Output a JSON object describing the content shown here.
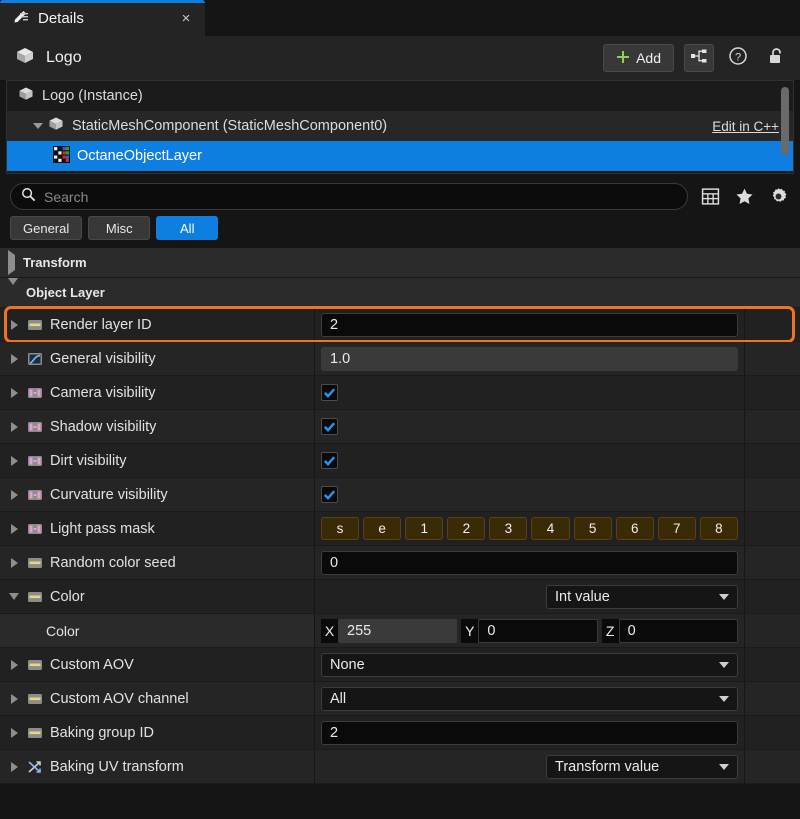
{
  "tab": {
    "label": "Details",
    "close": "×",
    "icon": "details-pencil-icon"
  },
  "header": {
    "title": "Logo",
    "add_label": "Add",
    "buttons": [
      "add-button",
      "hierarchy-button",
      "help-button",
      "lock-button"
    ]
  },
  "tree": {
    "rows": [
      {
        "label": "Logo (Instance)",
        "indent": 0,
        "selected": false,
        "icon": "cube-icon"
      },
      {
        "label": "StaticMeshComponent (StaticMeshComponent0)",
        "indent": 1,
        "selected": false,
        "icon": "cube-icon",
        "link": "Edit in C++"
      },
      {
        "label": "OctaneObjectLayer",
        "indent": 2,
        "selected": true,
        "icon": "octane-layer-icon"
      }
    ]
  },
  "search": {
    "placeholder": "Search",
    "value": "",
    "icons": [
      "grid-icon",
      "star-icon",
      "gear-icon"
    ]
  },
  "filters": [
    {
      "label": "General",
      "active": false
    },
    {
      "label": "Misc",
      "active": false
    },
    {
      "label": "All",
      "active": true
    }
  ],
  "categories": {
    "transform": {
      "label": "Transform",
      "expanded": false
    },
    "object_layer": {
      "label": "Object Layer",
      "expanded": true
    }
  },
  "properties": [
    {
      "name": "Render layer ID",
      "icon": "int-icon",
      "type": "text",
      "value": "2",
      "highlighted": true
    },
    {
      "name": "General visibility",
      "icon": "float-curve-icon",
      "type": "text",
      "value": "1.0",
      "hover": true
    },
    {
      "name": "Camera visibility",
      "icon": "bool-icon",
      "type": "checkbox",
      "checked": true
    },
    {
      "name": "Shadow visibility",
      "icon": "bool-icon",
      "type": "checkbox",
      "checked": true
    },
    {
      "name": "Dirt visibility",
      "icon": "bool-icon",
      "type": "checkbox",
      "checked": true
    },
    {
      "name": "Curvature visibility",
      "icon": "bool-icon",
      "type": "checkbox",
      "checked": true
    },
    {
      "name": "Light pass mask",
      "icon": "bool-icon",
      "type": "mask",
      "mask": [
        "s",
        "e",
        "1",
        "2",
        "3",
        "4",
        "5",
        "6",
        "7",
        "8"
      ]
    },
    {
      "name": "Random color seed",
      "icon": "int-icon",
      "type": "text",
      "value": "0"
    },
    {
      "name": "Color",
      "icon": "int-icon",
      "type": "dropdown-right",
      "value": "Int value",
      "expanded": true
    },
    {
      "name": "Color",
      "icon": "none",
      "type": "vector",
      "child": true,
      "axes": [
        {
          "label": "X",
          "value": "255",
          "hover": true
        },
        {
          "label": "Y",
          "value": "0",
          "hover": false
        },
        {
          "label": "Z",
          "value": "0",
          "hover": false
        }
      ]
    },
    {
      "name": "Custom AOV",
      "icon": "int-icon",
      "type": "dropdown",
      "value": "None"
    },
    {
      "name": "Custom AOV channel",
      "icon": "int-icon",
      "type": "dropdown",
      "value": "All"
    },
    {
      "name": "Baking group ID",
      "icon": "int-icon",
      "type": "text",
      "value": "2"
    },
    {
      "name": "Baking UV transform",
      "icon": "transform-icon",
      "type": "dropdown-right",
      "value": "Transform value"
    }
  ],
  "colors": {
    "accent_blue": "#0e7fe1",
    "highlight_orange": "#f07323",
    "panel_bg": "#212121",
    "mask_amber": "#3b2a06",
    "add_plus_green": "#8ed14f"
  }
}
